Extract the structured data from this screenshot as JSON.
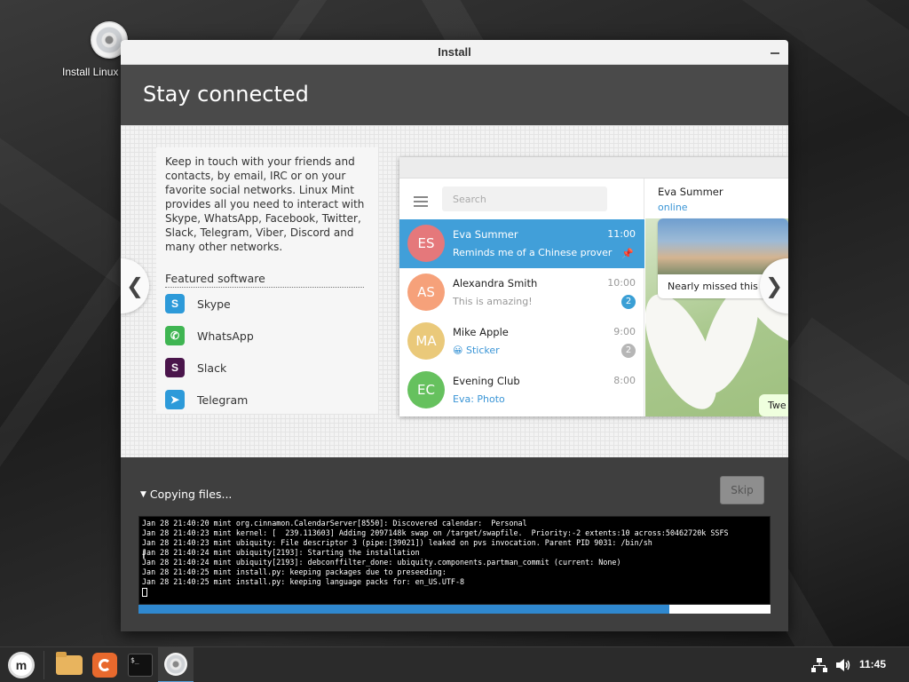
{
  "desktop": {
    "icon_label": "Install Linux Mint"
  },
  "window": {
    "title": "Install",
    "heading": "Stay connected"
  },
  "slide": {
    "description": "Keep in touch with your friends and contacts, by email, IRC or on your favorite social networks. Linux Mint provides all you need to interact with Skype, WhatsApp, Facebook, Twitter, Slack, Telegram, Viber, Discord and many other networks.",
    "featured_heading": "Featured software",
    "software": [
      {
        "name": "Skype",
        "icon": "skype-icon",
        "color": "#2d9ad9",
        "glyph": "S"
      },
      {
        "name": "WhatsApp",
        "icon": "whatsapp-icon",
        "color": "#3fb552",
        "glyph": "✆"
      },
      {
        "name": "Slack",
        "icon": "slack-icon",
        "color": "#4a154b",
        "glyph": "S"
      },
      {
        "name": "Telegram",
        "icon": "telegram-icon",
        "color": "#2d9ad9",
        "glyph": "➤"
      }
    ],
    "telegram": {
      "search_placeholder": "Search",
      "chats": [
        {
          "initials": "ES",
          "name": "Eva Summer",
          "time": "11:00",
          "message": "Reminds me of a Chinese prover…",
          "avatar_color": "#e5787b",
          "active": true
        },
        {
          "initials": "AS",
          "name": "Alexandra Smith",
          "time": "10:00",
          "message": "This is amazing!",
          "avatar_color": "#f6a17a",
          "badge": "2",
          "badge_color": "#3a9fd5"
        },
        {
          "initials": "MA",
          "name": "Mike Apple",
          "time": "9:00",
          "message": "😀 Sticker",
          "avatar_color": "#eac97a",
          "badge": "2",
          "badge_color": "#b6b6b6"
        },
        {
          "initials": "EC",
          "name": "Evening Club",
          "time": "8:00",
          "message": "Eva: Photo",
          "avatar_color": "#66c15e"
        }
      ],
      "contact_name": "Eva Summer",
      "contact_status": "online",
      "message_text": "Nearly missed this s",
      "small_message": "Twe"
    }
  },
  "progress": {
    "status": "Copying files...",
    "skip_label": "Skip",
    "fraction": 0.84,
    "log": [
      "Jan 28 21:40:20 mint org.cinnamon.CalendarServer[8550]: Discovered calendar:  Personal",
      "Jan 28 21:40:23 mint kernel: [  239.113603] Adding 2097148k swap on /target/swapfile.  Priority:-2 extents:10 across:50462720k SSFS",
      "Jan 28 21:40:23 mint ubiquity: File descriptor 3 (pipe:[39021]) leaked on pvs invocation. Parent PID 9031: /bin/sh",
      "Jan 28 21:40:24 mint ubiquity[2193]: Starting the installation",
      "Jan 28 21:40:24 mint ubiquity[2193]: debconffilter_done: ubiquity.components.partman_commit (current: None)",
      "Jan 28 21:40:25 mint install.py: keeping packages due to preseeding:",
      "Jan 28 21:40:25 mint install.py: keeping language packs for: en_US.UTF-8"
    ]
  },
  "taskbar": {
    "clock": "11:45",
    "terminal_prompt": "$_"
  }
}
